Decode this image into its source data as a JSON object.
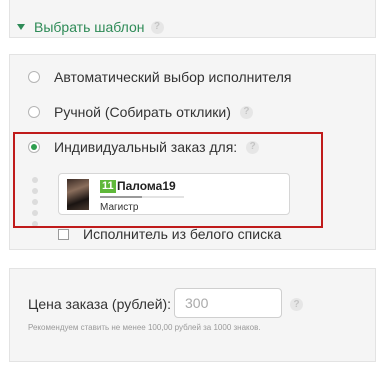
{
  "header": {
    "label": "Выбрать шаблон",
    "help_icon": "?"
  },
  "options": [
    {
      "label": "Автоматический выбор исполнителя",
      "checked": false,
      "has_help": false
    },
    {
      "label": "Ручной (Собирать отклики)",
      "checked": false,
      "has_help": true
    },
    {
      "label": "Индивидуальный заказ для:",
      "checked": true,
      "has_help": true
    }
  ],
  "performer": {
    "level": "11",
    "name": "Палома19",
    "rank": "Магистр",
    "progress": 0.5,
    "level_color": "#5fb83a"
  },
  "whitelist": {
    "label": "Исполнитель из белого списка",
    "checked": false
  },
  "price": {
    "label": "Цена заказа (рублей):",
    "value": "",
    "placeholder": "300",
    "note": "Рекомендуем ставить не менее 100,00 рублей за 1000 знаков."
  },
  "colors": {
    "accent": "#2e8b57",
    "highlight": "#c01b1b",
    "radio_checked": "#2e9e4e"
  }
}
